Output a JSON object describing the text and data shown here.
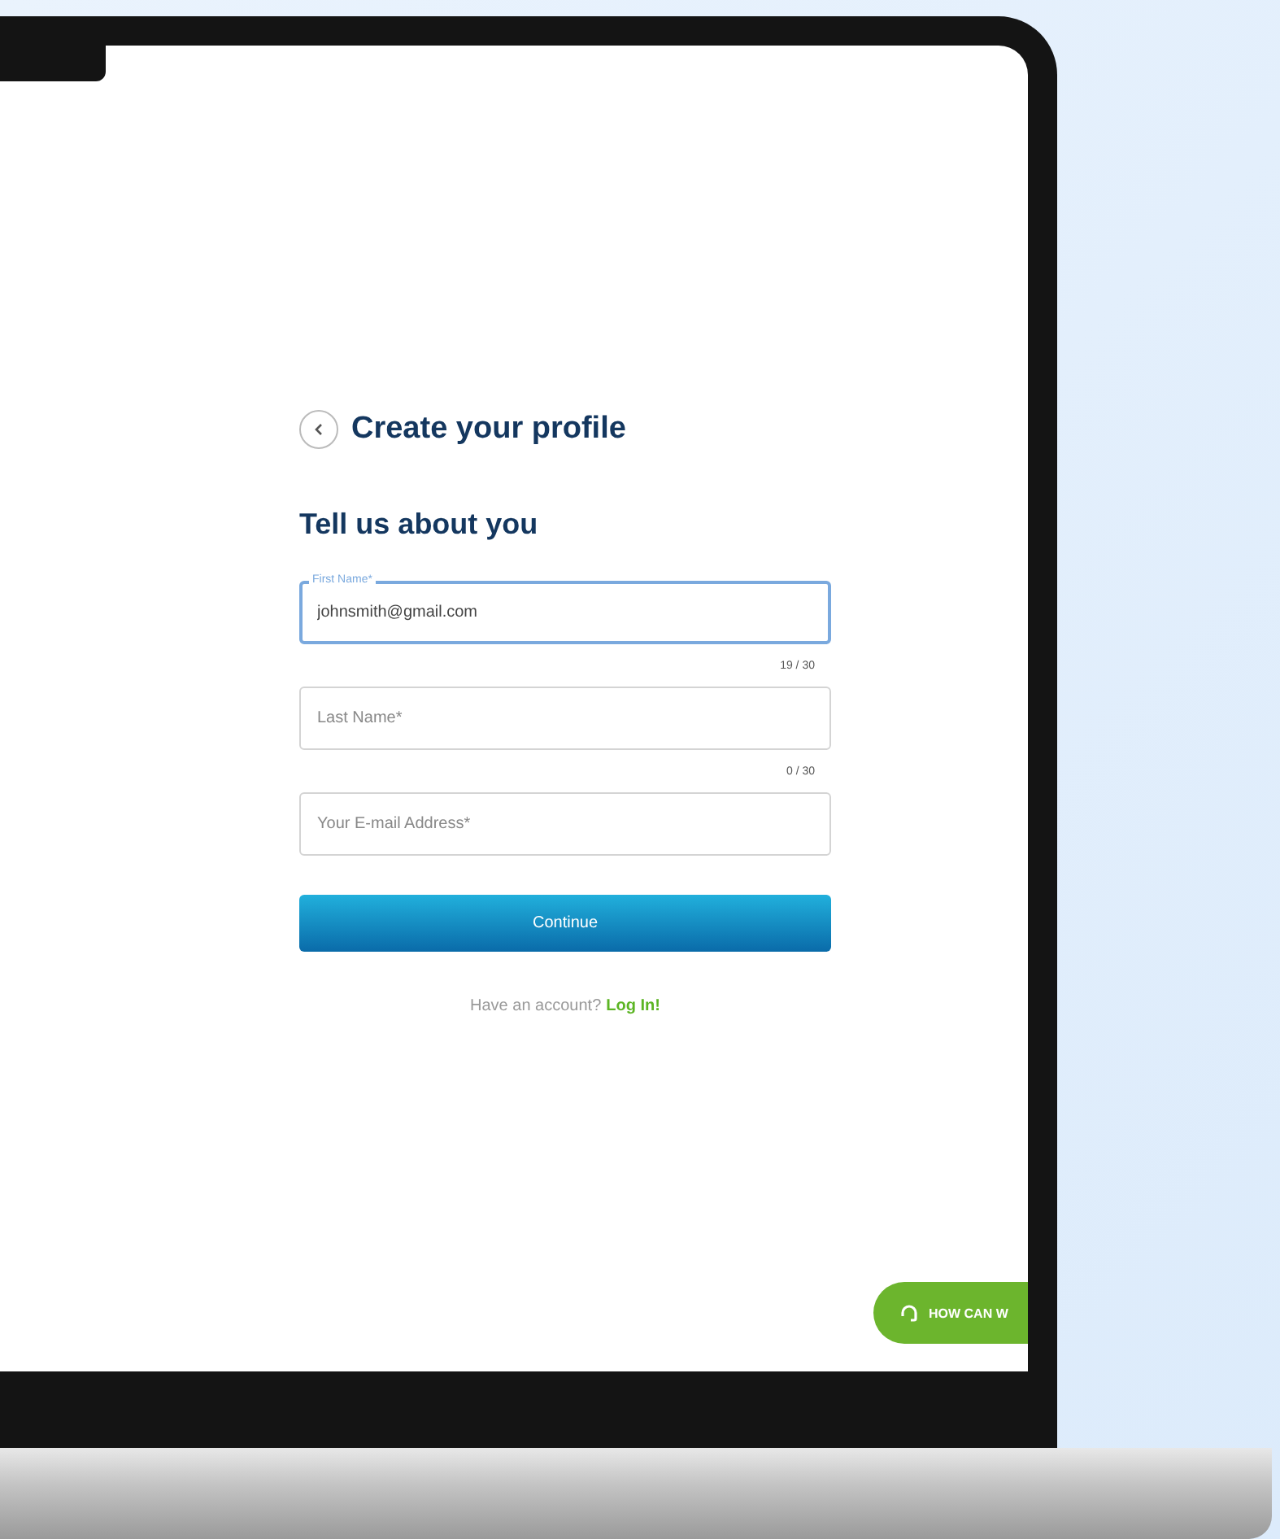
{
  "header": {
    "title": "Create your profile"
  },
  "form": {
    "heading": "Tell us about you",
    "fields": [
      {
        "label": "First Name*",
        "value": "johnsmith@gmail.com",
        "counter": "19 / 30",
        "focused": true
      },
      {
        "placeholder": "Last Name*",
        "counter": "0 / 30",
        "focused": false
      },
      {
        "placeholder": "Your E-mail Address*",
        "focused": false
      }
    ],
    "submit": "Continue",
    "login_prompt": "Have an account?",
    "login_link": "Log In!"
  },
  "help_button": {
    "label": "HOW CAN W"
  }
}
